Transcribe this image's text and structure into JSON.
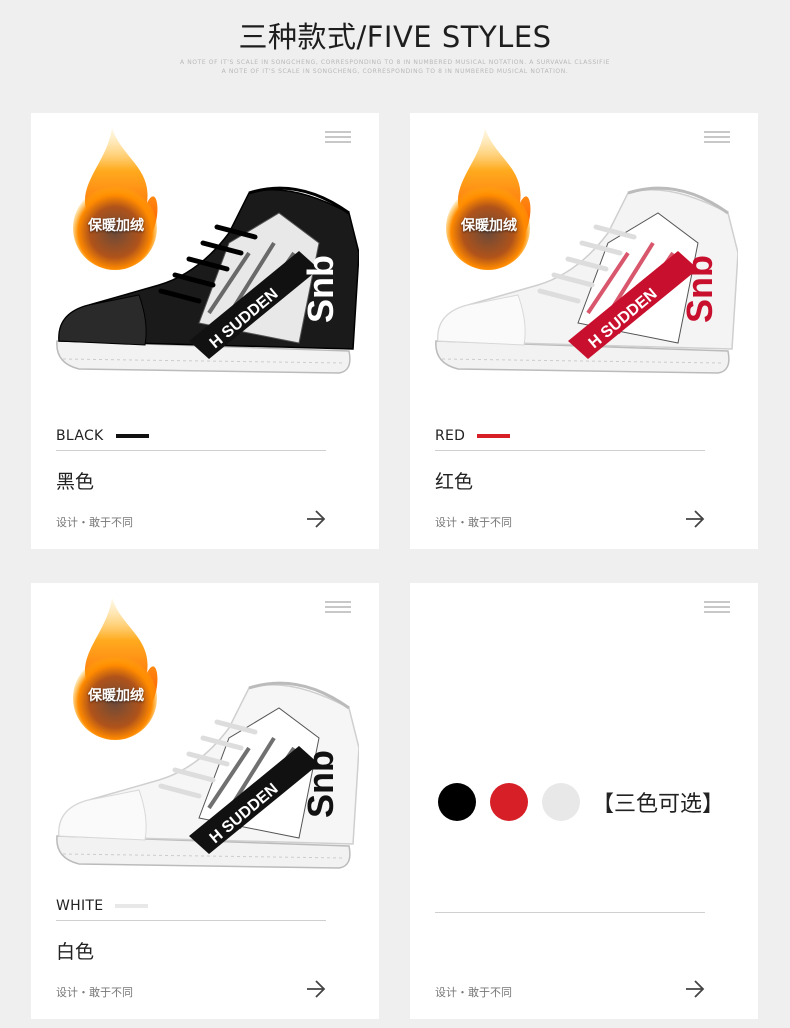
{
  "header": {
    "title": "三种款式/FIVE STYLES",
    "subline1": "A NOTE OF IT'S SCALE IN SONGCHENG, CORRESPONDING TO 8 IN NUMBERED MUSICAL NOTATION. A SURVAVAL CLASSIFIE",
    "subline2": "A NOTE OF IT'S SCALE IN SONGCHENG, CORRESPONDING TO 8 IN NUMBERED MUSICAL NOTATION."
  },
  "badge_label": "保暖加绒",
  "tagline": "设计・敢于不同",
  "shoe_brand_text": "Snb",
  "shoe_strip_text": "H SUDDEN",
  "cards": [
    {
      "color_en": "BLACK",
      "color_cn": "黑色",
      "bar_color": "#111111",
      "shoe_base": "#1a1a1a",
      "shoe_accent": "#ffffff"
    },
    {
      "color_en": "RED",
      "color_cn": "红色",
      "bar_color": "#d61f26",
      "shoe_base": "#f4f4f4",
      "shoe_accent": "#c8102e"
    },
    {
      "color_en": "WHITE",
      "color_cn": "白色",
      "bar_color": "#e8e8e8",
      "shoe_base": "#f6f6f6",
      "shoe_accent": "#111111"
    }
  ],
  "options_card": {
    "swatches": [
      "#000000",
      "#d61f26",
      "#e8e8e8"
    ],
    "note": "【三色可选】"
  }
}
